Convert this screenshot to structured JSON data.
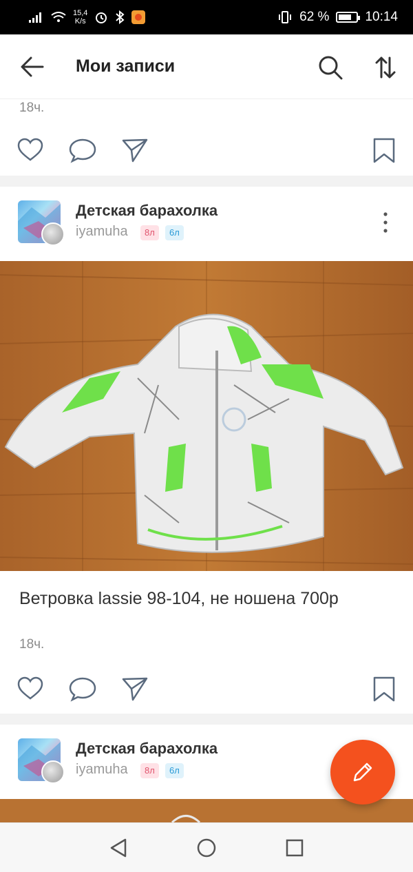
{
  "status_bar": {
    "speed_value": "15,4",
    "speed_unit": "K/s",
    "battery_percent": "62 %",
    "time": "10:14"
  },
  "header": {
    "title": "Мои записи",
    "icons": [
      "back-arrow-icon",
      "search-icon",
      "sort-icon"
    ]
  },
  "prev_post": {
    "time": "18ч."
  },
  "posts": [
    {
      "group": "Детская барахолка",
      "user": "iyamuha",
      "badge_pink": "8л",
      "badge_blue": "6л",
      "text": "Ветровка lassie 98-104, не ношена 700р",
      "time": "18ч."
    },
    {
      "group": "Детская барахолка",
      "user": "iyamuha",
      "badge_pink": "8л",
      "badge_blue": "6л"
    }
  ],
  "colors": {
    "accent": "#f4511e",
    "status_bar": "#000000",
    "badge_pink_bg": "#ffe1e6",
    "badge_blue_bg": "#dff2fb",
    "wood": "#b5702e",
    "jacket_green": "#6fe04a"
  },
  "action_icons": [
    "heart-icon",
    "comment-icon",
    "share-icon",
    "bookmark-icon"
  ],
  "nav_icons": [
    "nav-back-icon",
    "nav-home-icon",
    "nav-recents-icon"
  ]
}
